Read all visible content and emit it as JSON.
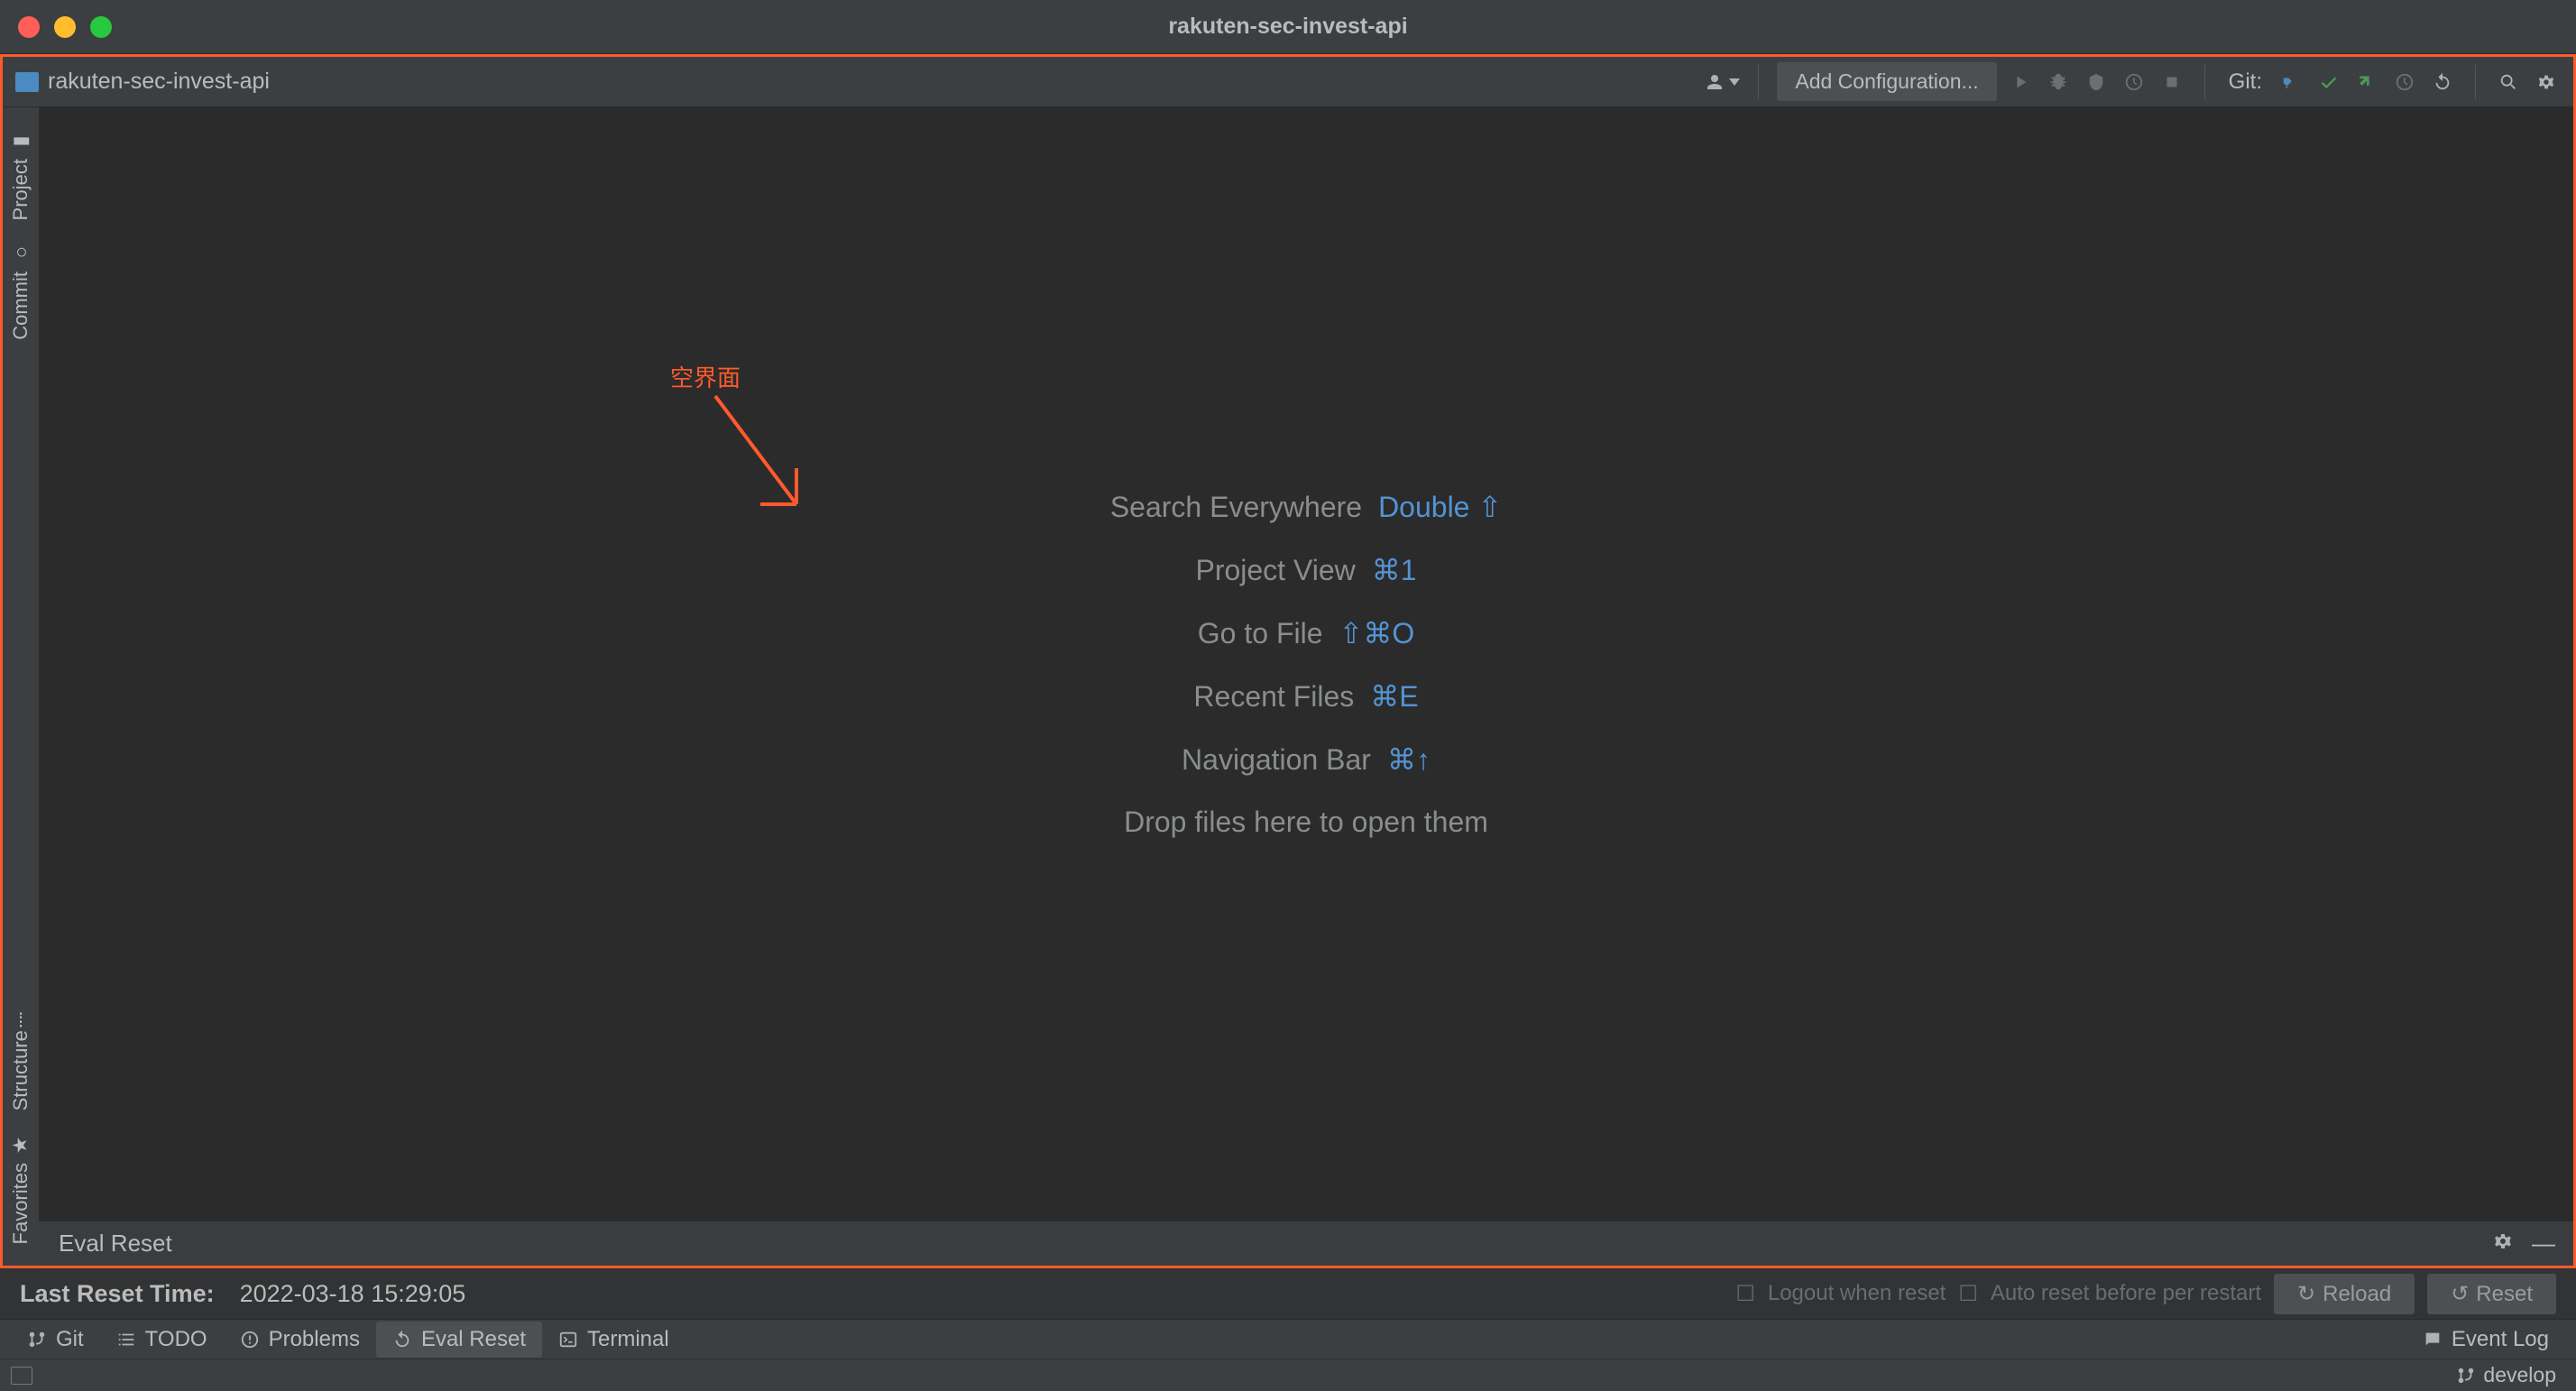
{
  "window": {
    "title": "rakuten-sec-invest-api"
  },
  "toolbar": {
    "breadcrumb": "rakuten-sec-invest-api",
    "add_configuration": "Add Configuration...",
    "git_label": "Git:"
  },
  "left_rail": {
    "project": "Project",
    "commit": "Commit",
    "structure": "Structure",
    "favorites": "Favorites"
  },
  "editor_hints": {
    "search_everywhere": {
      "label": "Search Everywhere",
      "key": "Double ⇧"
    },
    "project_view": {
      "label": "Project View",
      "key": "⌘1"
    },
    "go_to_file": {
      "label": "Go to File",
      "key": "⇧⌘O"
    },
    "recent_files": {
      "label": "Recent Files",
      "key": "⌘E"
    },
    "navigation_bar": {
      "label": "Navigation Bar",
      "key": "⌘↑"
    },
    "drop_hint": "Drop files here to open them"
  },
  "annotation": {
    "text": "空界面"
  },
  "eval_bar": {
    "title": "Eval Reset"
  },
  "reset_row": {
    "label": "Last Reset Time:",
    "time": "2022-03-18 15:29:05",
    "logout": "Logout when reset",
    "auto": "Auto reset before per restart",
    "reload": "Reload",
    "reset": "Reset"
  },
  "bottom_strip": {
    "git": "Git",
    "todo": "TODO",
    "problems": "Problems",
    "eval_reset": "Eval Reset",
    "terminal": "Terminal",
    "event_log": "Event Log"
  },
  "status_bar": {
    "branch": "develop"
  }
}
